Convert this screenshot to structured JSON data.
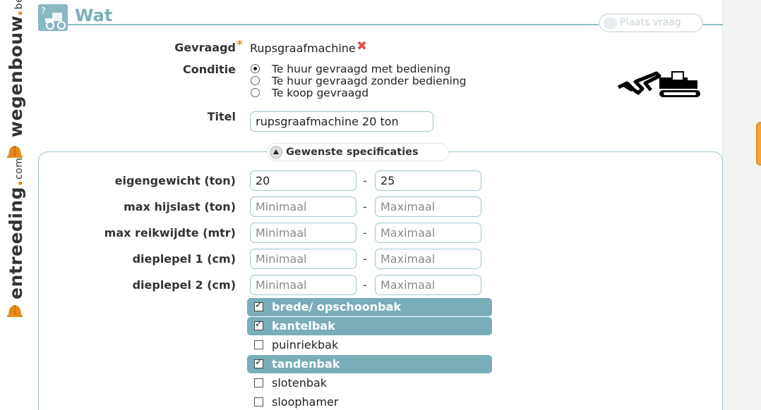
{
  "brand": {
    "logo_1": {
      "name": "wegenbouw",
      "dot": ".",
      "tld": "be"
    },
    "logo_2": {
      "name": "entreeding",
      "dot": ".",
      "tld": "com"
    }
  },
  "header": {
    "title": "Wat",
    "ask_button": "Plaats vraag"
  },
  "form": {
    "gevraagd": {
      "label": "Gevraagd",
      "required_mark": "*",
      "value": "Rupsgraafmachine"
    },
    "conditie": {
      "label": "Conditie",
      "options": [
        {
          "label": "Te huur gevraagd met bediening",
          "selected": true
        },
        {
          "label": "Te huur gevraagd zonder bediening",
          "selected": false
        },
        {
          "label": "Te koop gevraagd",
          "selected": false
        }
      ]
    },
    "titel": {
      "label": "Titel",
      "value": "rupsgraafmachine 20 ton"
    }
  },
  "specs": {
    "legend": "Gewenste specificaties",
    "dash": "-",
    "rows": [
      {
        "label": "eigengewicht (ton)",
        "min_value": "20",
        "max_value": "25",
        "min_placeholder": "Minimaal",
        "max_placeholder": "Maximaal"
      },
      {
        "label": "max hijslast (ton)",
        "min_value": "",
        "max_value": "",
        "min_placeholder": "Minimaal",
        "max_placeholder": "Maximaal"
      },
      {
        "label": "max reikwijdte (mtr)",
        "min_value": "",
        "max_value": "",
        "min_placeholder": "Minimaal",
        "max_placeholder": "Maximaal"
      },
      {
        "label": "dieplepel 1 (cm)",
        "min_value": "",
        "max_value": "",
        "min_placeholder": "Minimaal",
        "max_placeholder": "Maximaal"
      },
      {
        "label": "dieplepel 2 (cm)",
        "min_value": "",
        "max_value": "",
        "min_placeholder": "Minimaal",
        "max_placeholder": "Maximaal"
      }
    ],
    "options": [
      {
        "label": "brede/ opschoonbak",
        "checked": true
      },
      {
        "label": "kantelbak",
        "checked": true
      },
      {
        "label": "puinriekbak",
        "checked": false
      },
      {
        "label": "tandenbak",
        "checked": true
      },
      {
        "label": "slotenbak",
        "checked": false
      },
      {
        "label": "sloophamer",
        "checked": false
      }
    ]
  },
  "colors": {
    "accent": "#79aeb9",
    "brand_orange": "#e8891a",
    "remove": "#d9534f"
  },
  "icons": [
    "helmet-icon",
    "help-loader-icon",
    "chat-bubble-icon",
    "remove-icon",
    "excavator-icon",
    "collapse-arrow-icon"
  ]
}
